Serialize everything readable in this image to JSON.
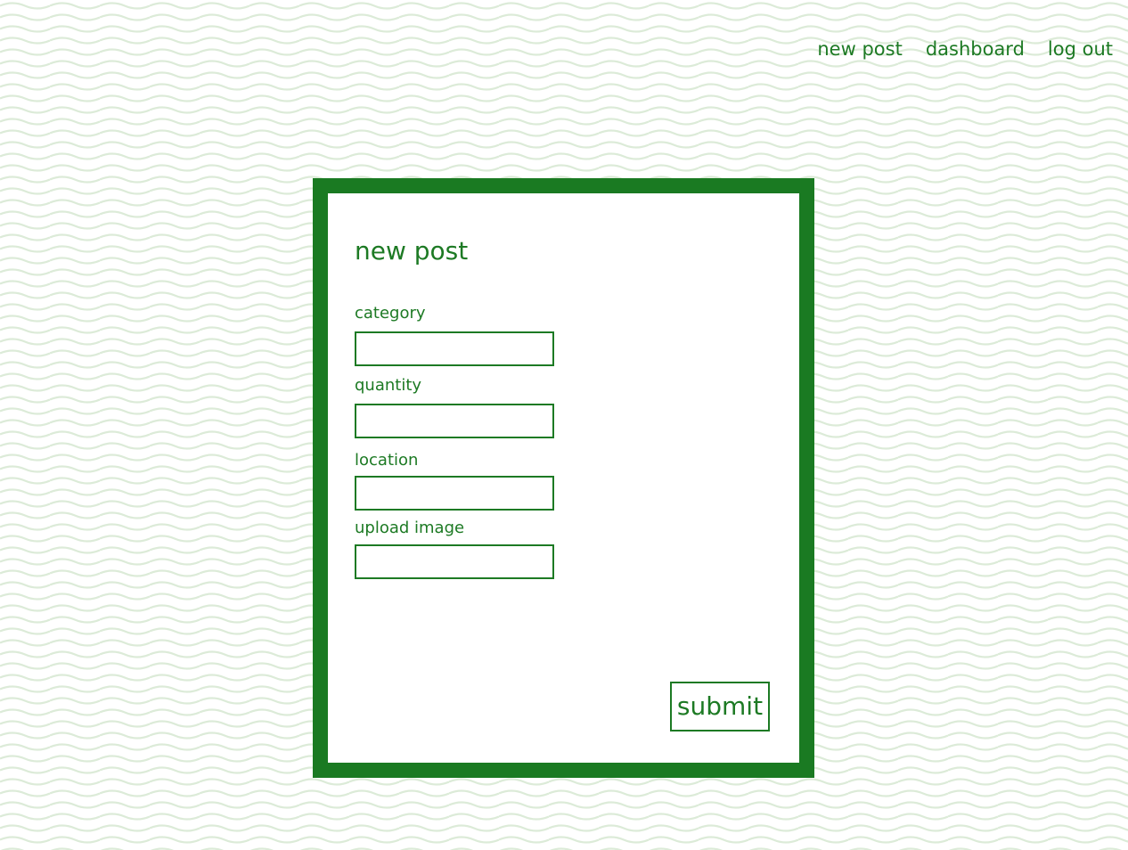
{
  "nav": {
    "items": [
      {
        "label": "new post"
      },
      {
        "label": "dashboard"
      },
      {
        "label": "log out"
      }
    ]
  },
  "form": {
    "title": "new post",
    "fields": [
      {
        "label": "category",
        "value": ""
      },
      {
        "label": "quantity",
        "value": ""
      },
      {
        "label": "location",
        "value": ""
      },
      {
        "label": "upload image",
        "value": ""
      }
    ],
    "submit_label": "submit"
  },
  "colors": {
    "accent": "#1a7a22",
    "text": "#1d7a24",
    "pattern": "#dcebd8",
    "background": "#ffffff"
  }
}
